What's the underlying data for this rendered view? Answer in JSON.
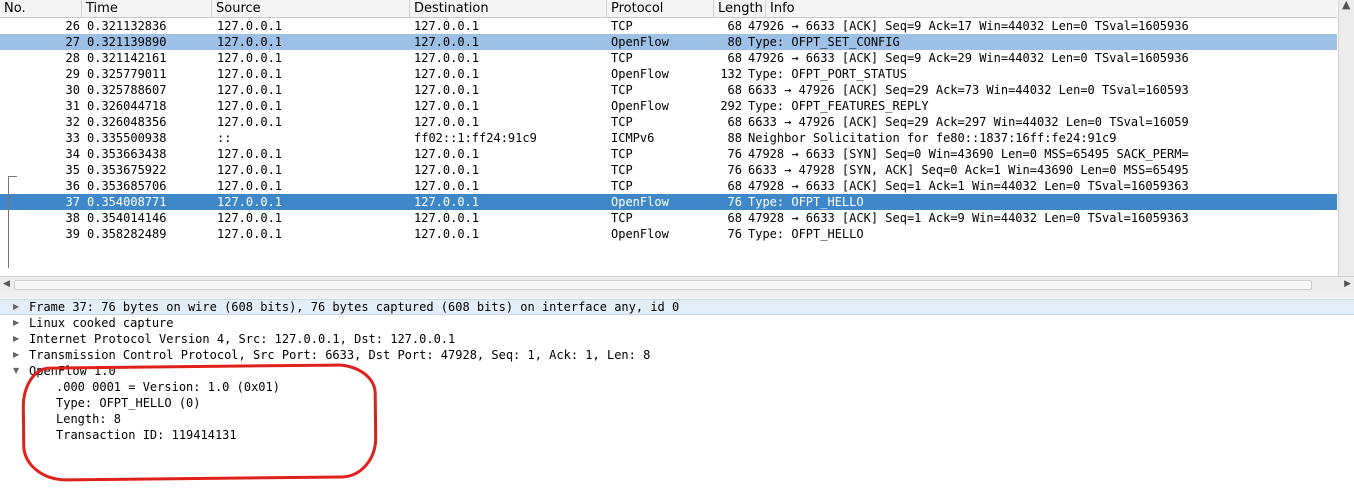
{
  "columns": [
    "No.",
    "Time",
    "Source",
    "Destination",
    "Protocol",
    "Length",
    "Info"
  ],
  "packets": [
    {
      "no": "26",
      "time": "0.321132836",
      "src": "127.0.0.1",
      "dst": "127.0.0.1",
      "proto": "TCP",
      "len": "68",
      "info": "47926 → 6633 [ACK] Seq=9 Ack=17 Win=44032 Len=0 TSval=1605936"
    },
    {
      "no": "27",
      "time": "0.321139890",
      "src": "127.0.0.1",
      "dst": "127.0.0.1",
      "proto": "OpenFlow",
      "len": "80",
      "info": "Type: OFPT_SET_CONFIG"
    },
    {
      "no": "28",
      "time": "0.321142161",
      "src": "127.0.0.1",
      "dst": "127.0.0.1",
      "proto": "TCP",
      "len": "68",
      "info": "47926 → 6633 [ACK] Seq=9 Ack=29 Win=44032 Len=0 TSval=1605936"
    },
    {
      "no": "29",
      "time": "0.325779011",
      "src": "127.0.0.1",
      "dst": "127.0.0.1",
      "proto": "OpenFlow",
      "len": "132",
      "info": "Type: OFPT_PORT_STATUS"
    },
    {
      "no": "30",
      "time": "0.325788607",
      "src": "127.0.0.1",
      "dst": "127.0.0.1",
      "proto": "TCP",
      "len": "68",
      "info": "6633 → 47926 [ACK] Seq=29 Ack=73 Win=44032 Len=0 TSval=160593"
    },
    {
      "no": "31",
      "time": "0.326044718",
      "src": "127.0.0.1",
      "dst": "127.0.0.1",
      "proto": "OpenFlow",
      "len": "292",
      "info": "Type: OFPT_FEATURES_REPLY"
    },
    {
      "no": "32",
      "time": "0.326048356",
      "src": "127.0.0.1",
      "dst": "127.0.0.1",
      "proto": "TCP",
      "len": "68",
      "info": "6633 → 47926 [ACK] Seq=29 Ack=297 Win=44032 Len=0 TSval=16059"
    },
    {
      "no": "33",
      "time": "0.335500938",
      "src": "::",
      "dst": "ff02::1:ff24:91c9",
      "proto": "ICMPv6",
      "len": "88",
      "info": "Neighbor Solicitation for fe80::1837:16ff:fe24:91c9"
    },
    {
      "no": "34",
      "time": "0.353663438",
      "src": "127.0.0.1",
      "dst": "127.0.0.1",
      "proto": "TCP",
      "len": "76",
      "info": "47928 → 6633 [SYN] Seq=0 Win=43690 Len=0 MSS=65495 SACK_PERM="
    },
    {
      "no": "35",
      "time": "0.353675922",
      "src": "127.0.0.1",
      "dst": "127.0.0.1",
      "proto": "TCP",
      "len": "76",
      "info": "6633 → 47928 [SYN, ACK] Seq=0 Ack=1 Win=43690 Len=0 MSS=65495"
    },
    {
      "no": "36",
      "time": "0.353685706",
      "src": "127.0.0.1",
      "dst": "127.0.0.1",
      "proto": "TCP",
      "len": "68",
      "info": "47928 → 6633 [ACK] Seq=1 Ack=1 Win=44032 Len=0 TSval=16059363"
    },
    {
      "no": "37",
      "time": "0.354008771",
      "src": "127.0.0.1",
      "dst": "127.0.0.1",
      "proto": "OpenFlow",
      "len": "76",
      "info": "Type: OFPT_HELLO"
    },
    {
      "no": "38",
      "time": "0.354014146",
      "src": "127.0.0.1",
      "dst": "127.0.0.1",
      "proto": "TCP",
      "len": "68",
      "info": "47928 → 6633 [ACK] Seq=1 Ack=9 Win=44032 Len=0 TSval=16059363"
    },
    {
      "no": "39",
      "time": "0.358282489",
      "src": "127.0.0.1",
      "dst": "127.0.0.1",
      "proto": "OpenFlow",
      "len": "76",
      "info": "Type: OFPT_HELLO"
    }
  ],
  "details": [
    {
      "text": "Frame 37: 76 bytes on wire (608 bits), 76 bytes captured (608 bits) on interface any, id 0",
      "arrow": "▶"
    },
    {
      "text": "Linux cooked capture",
      "arrow": "▶"
    },
    {
      "text": "Internet Protocol Version 4, Src: 127.0.0.1, Dst: 127.0.0.1",
      "arrow": "▶"
    },
    {
      "text": "Transmission Control Protocol, Src Port: 6633, Dst Port: 47928, Seq: 1, Ack: 1, Len: 8",
      "arrow": "▶"
    },
    {
      "text": "OpenFlow 1.0",
      "arrow": "▼"
    },
    {
      "text": ".000 0001 = Version: 1.0 (0x01)",
      "arrow": ""
    },
    {
      "text": "Type: OFPT_HELLO (0)",
      "arrow": ""
    },
    {
      "text": "Length: 8",
      "arrow": ""
    },
    {
      "text": "Transaction ID: 119414131",
      "arrow": ""
    }
  ],
  "colors": {
    "selected_row": "#3e87c9",
    "related_row": "#9dc1e6",
    "annotation": "#e0201a"
  }
}
